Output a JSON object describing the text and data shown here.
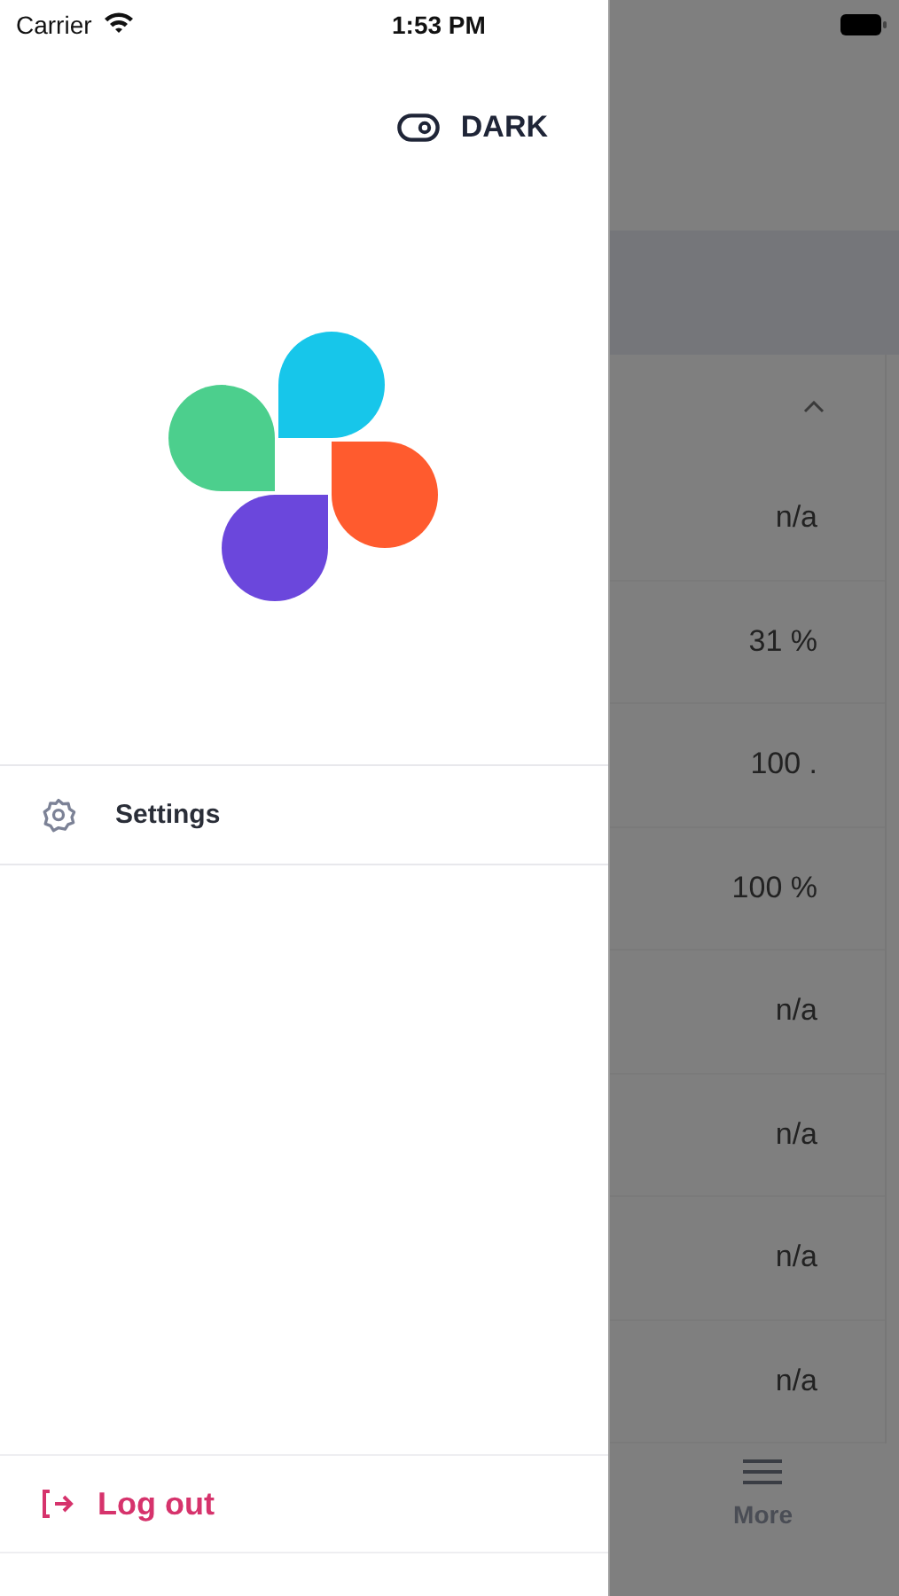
{
  "status_bar": {
    "carrier": "Carrier",
    "time": "1:53 PM"
  },
  "drawer": {
    "theme_toggle": {
      "label": "DARK"
    },
    "menu_items": [
      {
        "label": "Settings"
      }
    ],
    "logout": {
      "label": "Log out"
    }
  },
  "background": {
    "rows": [
      {
        "value": "n/a"
      },
      {
        "value": "31 %"
      },
      {
        "value": "100 ."
      },
      {
        "value": "100 %"
      },
      {
        "value": "n/a"
      },
      {
        "value": "n/a"
      },
      {
        "value": "n/a"
      },
      {
        "value": "n/a"
      }
    ],
    "tab_bar": {
      "label": "More"
    }
  }
}
